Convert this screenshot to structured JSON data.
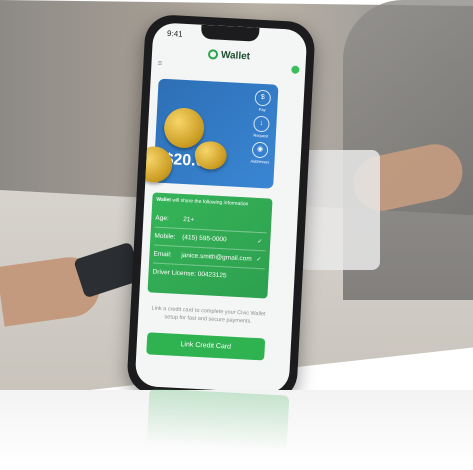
{
  "status_bar": {
    "time": "9:41"
  },
  "app": {
    "title": "Wallet"
  },
  "card": {
    "balance": "$20.00",
    "actions": [
      {
        "label": "Pay",
        "icon": "pay-icon"
      },
      {
        "label": "Request",
        "icon": "request-icon"
      },
      {
        "label": "Addresses",
        "icon": "location-icon"
      }
    ]
  },
  "share": {
    "brand": "Wallet",
    "heading": "will share the following information",
    "fields": [
      {
        "label": "Age:",
        "value": "21+"
      },
      {
        "label": "Mobile:",
        "value": "(415) 595-0000"
      },
      {
        "label": "Email:",
        "value": "janice.smith@gmail.com"
      },
      {
        "label": "Driver License:",
        "value": "00423125"
      }
    ]
  },
  "prompt": "Link a credit card to complete your Civic Wallet setup for fast and secure payments.",
  "link_button": "Link Credit Card",
  "colors": {
    "accent": "#2fb350",
    "card": "#2d6fb6"
  }
}
